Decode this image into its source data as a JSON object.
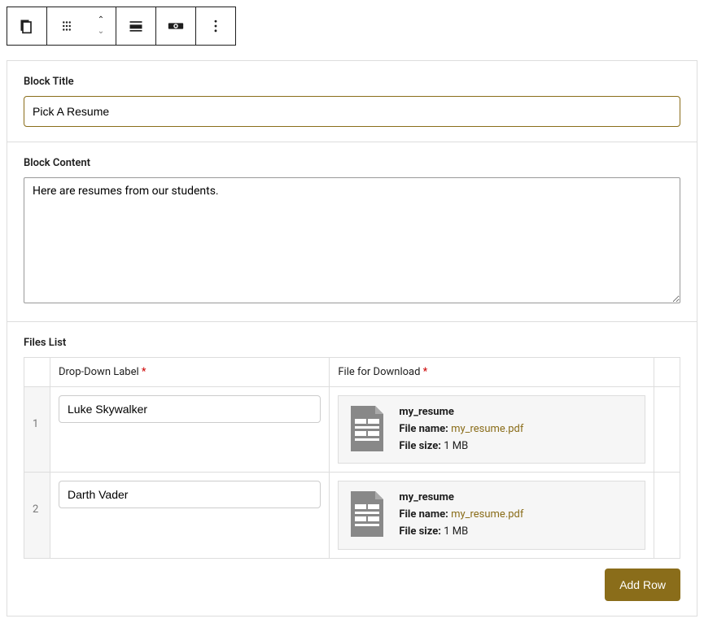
{
  "toolbar": {
    "icons": [
      "block-type",
      "drag",
      "move",
      "align",
      "visibility",
      "more"
    ]
  },
  "labels": {
    "block_title": "Block Title",
    "block_content": "Block Content",
    "files_list": "Files List",
    "col_dropdown": "Drop-Down Label",
    "col_file": "File for Download",
    "add_row": "Add Row",
    "file_name_label": "File name:",
    "file_size_label": "File size:"
  },
  "fields": {
    "title_value": "Pick A Resume",
    "content_value": "Here are resumes from our students."
  },
  "rows": [
    {
      "num": "1",
      "label": "Luke Skywalker",
      "file_title": "my_resume",
      "file_name": "my_resume.pdf",
      "file_size": "1 MB"
    },
    {
      "num": "2",
      "label": "Darth Vader",
      "file_title": "my_resume",
      "file_name": "my_resume.pdf",
      "file_size": "1 MB"
    }
  ]
}
